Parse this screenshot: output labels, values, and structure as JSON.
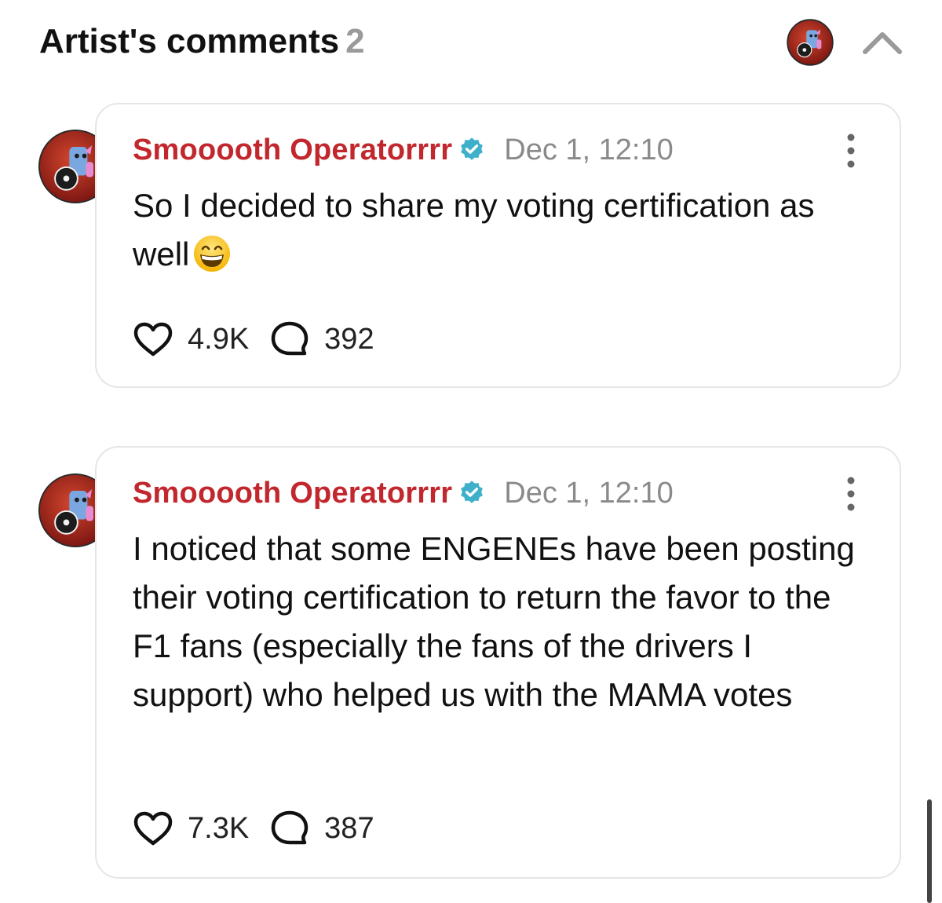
{
  "header": {
    "title": "Artist's comments",
    "count": "2"
  },
  "comments": [
    {
      "author": "Smooooth Operatorrrr",
      "timestamp": "Dec 1, 12:10",
      "text": "So I decided to share my voting certification as well",
      "emoji": "grinning-face-with-smiling-eyes",
      "likes": "4.9K",
      "replies": "392"
    },
    {
      "author": "Smooooth Operatorrrr",
      "timestamp": "Dec 1, 12:10",
      "text": "I noticed that some ENGENEs have been posting their voting certification to return the favor to the F1 fans (especially the fans of the drivers I support) who helped us with the MAMA votes",
      "likes": "7.3K",
      "replies": "387"
    }
  ],
  "icons": {
    "verified": "verified-badge-icon",
    "like": "heart-icon",
    "reply": "speech-bubble-icon",
    "more": "more-vertical-icon",
    "collapse": "chevron-up-icon"
  },
  "colors": {
    "author_name": "#c1272d",
    "verified_badge": "#3fb0c9",
    "timestamp": "#8a8a8a",
    "count": "#9a9a9a",
    "card_border": "#e6e6e6",
    "avatar_background": "#a8231e"
  }
}
